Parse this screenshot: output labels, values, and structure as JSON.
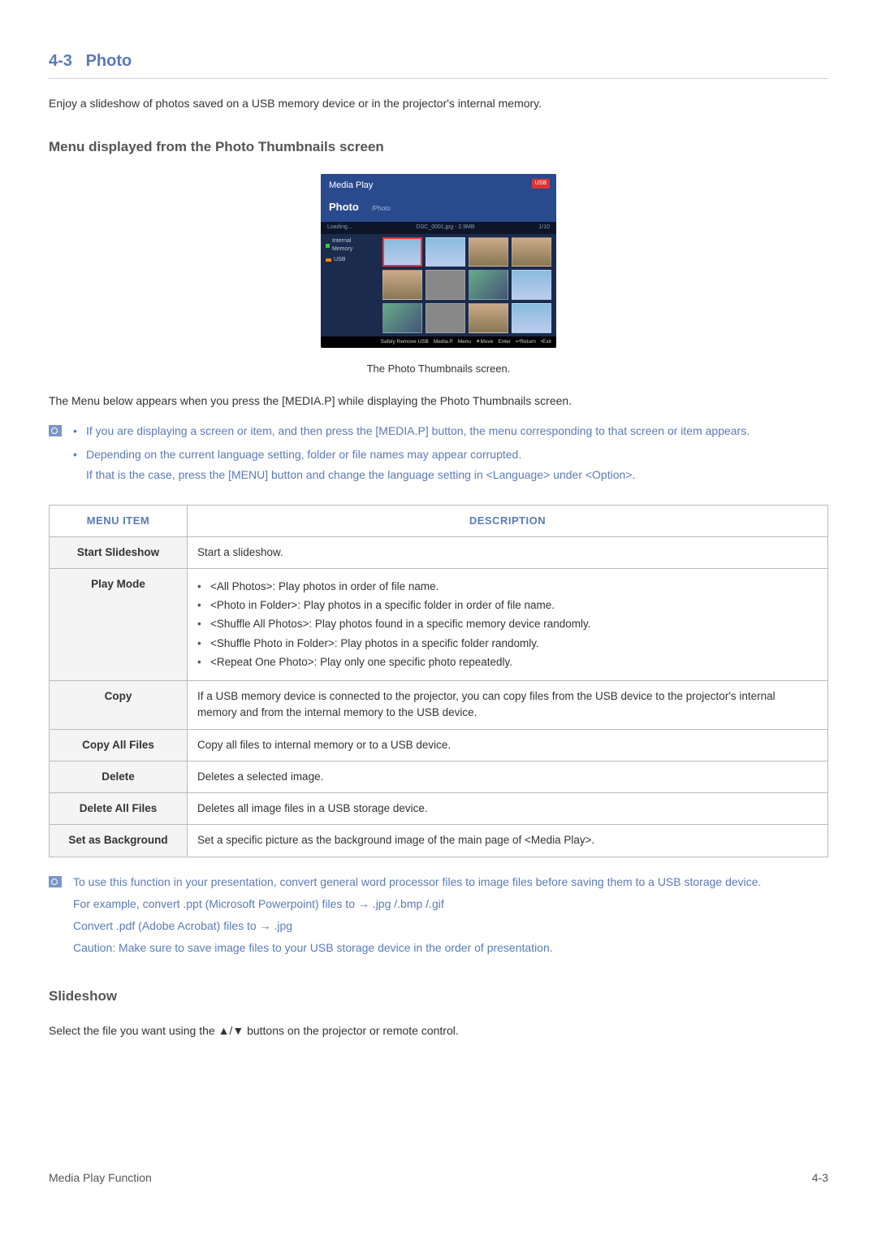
{
  "section": {
    "number": "4-3",
    "title": "Photo"
  },
  "intro": "Enjoy a slideshow of photos saved on a USB memory device or in the projector's internal memory.",
  "subsection1": "Menu displayed from the Photo Thumbnails screen",
  "screenshot": {
    "media_play": "Media Play",
    "usb_badge": "USB",
    "photo_label": "Photo",
    "path": "/Photo",
    "loading": "Loading...",
    "file_info": "DSC_0001.jpg - 2.9MB",
    "count": "1/10",
    "side_internal": "Internal Memory",
    "side_usb": "USB",
    "foot_safely": "Safely Remove USB",
    "foot_mediap": "Media.P",
    "foot_menu": "Menu",
    "foot_move": "Move",
    "foot_enter": "Enter",
    "foot_return": "Return",
    "foot_exit": "Exit"
  },
  "caption": "The Photo Thumbnails screen.",
  "after_caption": "The Menu below appears when you press the [MEDIA.P] while displaying the Photo Thumbnails screen.",
  "note1": {
    "item1": "If you are displaying a screen or item, and then press the [MEDIA.P] button, the menu corresponding to that screen or item appears.",
    "item2a": "Depending on the current language setting, folder or file names may appear corrupted.",
    "item2b": "If that is the case, press the [MENU] button and change the language setting in <Language> under <Option>."
  },
  "table": {
    "head_menu": "MENU ITEM",
    "head_desc": "DESCRIPTION",
    "rows": [
      {
        "label": "Start Slideshow",
        "desc": "Start a slideshow."
      },
      {
        "label": "Play Mode",
        "list": [
          "<All Photos>: Play photos in order of file name.",
          "<Photo in Folder>: Play photos in a specific folder in order of file name.",
          "<Shuffle All Photos>: Play photos found in a specific memory device randomly.",
          "<Shuffle Photo in Folder>: Play photos in a specific folder randomly.",
          "<Repeat One Photo>: Play only one specific photo repeatedly."
        ]
      },
      {
        "label": "Copy",
        "desc": "If a USB memory device is connected to the projector, you can copy files from the USB device to the projector's internal memory and from the internal memory to the USB device."
      },
      {
        "label": "Copy All Files",
        "desc": "Copy all files to internal memory or to a USB device."
      },
      {
        "label": "Delete",
        "desc": "Deletes a selected image."
      },
      {
        "label": "Delete All Files",
        "desc": "Deletes all image files in a USB storage device."
      },
      {
        "label": "Set as Background",
        "desc": "Set a specific picture as the background image of the main page of <Media Play>."
      }
    ]
  },
  "note2": {
    "p1": "To use this function in your presentation, convert general word processor files to image files before saving them to a USB storage device.",
    "p2": "For example, convert .ppt (Microsoft Powerpoint) files to → .jpg /.bmp /.gif",
    "p3": "Convert .pdf (Adobe Acrobat) files to → .jpg",
    "p4": "Caution: Make sure to save image files to your USB storage device in the order of presentation."
  },
  "subsection2": "Slideshow",
  "slideshow_text": "Select the file you want using the ▲/▼ buttons on the projector or remote control.",
  "footer": {
    "left": "Media Play Function",
    "right": "4-3"
  }
}
